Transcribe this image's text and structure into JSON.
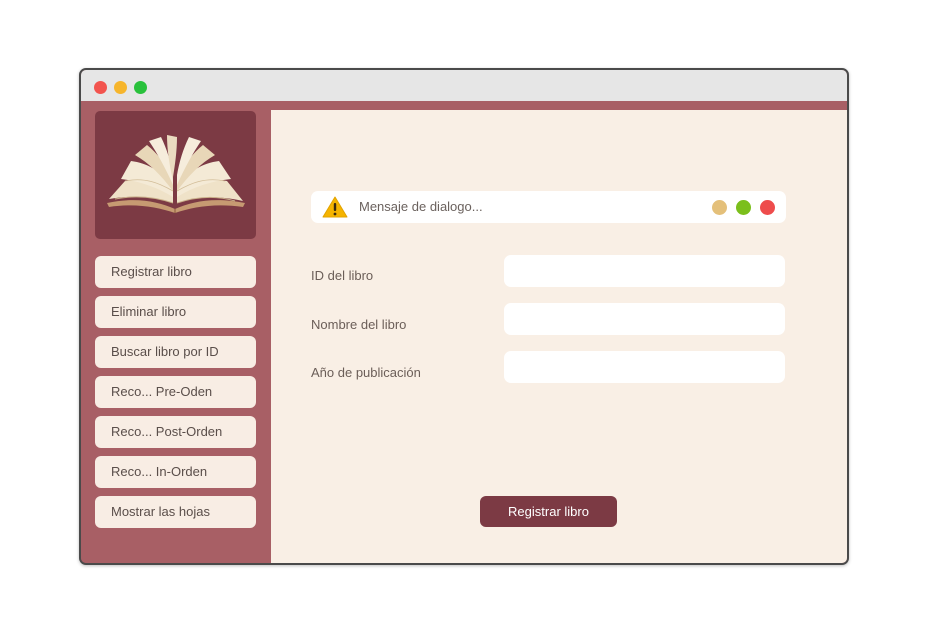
{
  "window": {
    "controls": [
      "close",
      "minimize",
      "maximize"
    ]
  },
  "sidebar": {
    "logo": "open-book-image",
    "items": [
      {
        "label": "Registrar libro"
      },
      {
        "label": "Eliminar libro"
      },
      {
        "label": "Buscar libro por ID"
      },
      {
        "label": "Reco... Pre-Oden"
      },
      {
        "label": "Reco... Post-Orden"
      },
      {
        "label": "Reco... In-Orden"
      },
      {
        "label": "Mostrar las hojas"
      }
    ]
  },
  "dialog": {
    "icon": "warning-icon",
    "message": "Mensaje de dialogo...",
    "indicator_colors": [
      "#e4c07a",
      "#7bbf1c",
      "#ee4c4c"
    ]
  },
  "form": {
    "fields": [
      {
        "label": "ID del libro",
        "value": ""
      },
      {
        "label": "Nombre del libro",
        "value": ""
      },
      {
        "label": "Año de publicación",
        "value": ""
      }
    ],
    "submit_label": "Registrar libro"
  },
  "colors": {
    "sidebar_bg": "#a85f65",
    "accent_dark": "#7c3a44",
    "main_bg": "#f9efe5",
    "button_bg": "#f8ede4"
  }
}
